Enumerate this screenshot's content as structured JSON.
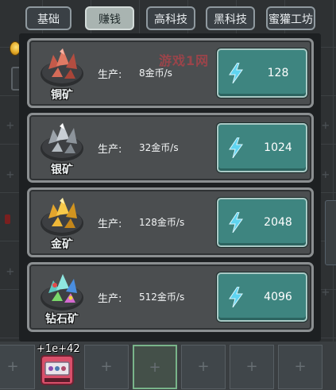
{
  "tabs": [
    {
      "label": "基础",
      "active": false
    },
    {
      "label": "赚钱",
      "active": true
    },
    {
      "label": "高科技",
      "active": false
    },
    {
      "label": "黑科技",
      "active": false
    },
    {
      "label": "蜜獾工坊",
      "active": false
    }
  ],
  "production_label": "生产:",
  "watermark": "游戏1网",
  "ores": [
    {
      "name": "铜矿",
      "rate": "8金币/s",
      "cost": "128",
      "icon": "copper-ore-icon",
      "color": "#d06a55"
    },
    {
      "name": "银矿",
      "rate": "32金币/s",
      "cost": "1024",
      "icon": "silver-ore-icon",
      "color": "#b8bec4"
    },
    {
      "name": "金矿",
      "rate": "128金币/s",
      "cost": "2048",
      "icon": "gold-ore-icon",
      "color": "#f2b83a"
    },
    {
      "name": "钻石矿",
      "rate": "512金币/s",
      "cost": "4096",
      "icon": "diamond-ore-icon",
      "color": "#6fd8d0"
    }
  ],
  "bottom": {
    "bonus": "+1e+42",
    "machine_icon": "gem-machine-icon"
  },
  "colors": {
    "button": "#3e8580",
    "card": "#4b4e50",
    "active_tab": "#a9b4b1"
  }
}
